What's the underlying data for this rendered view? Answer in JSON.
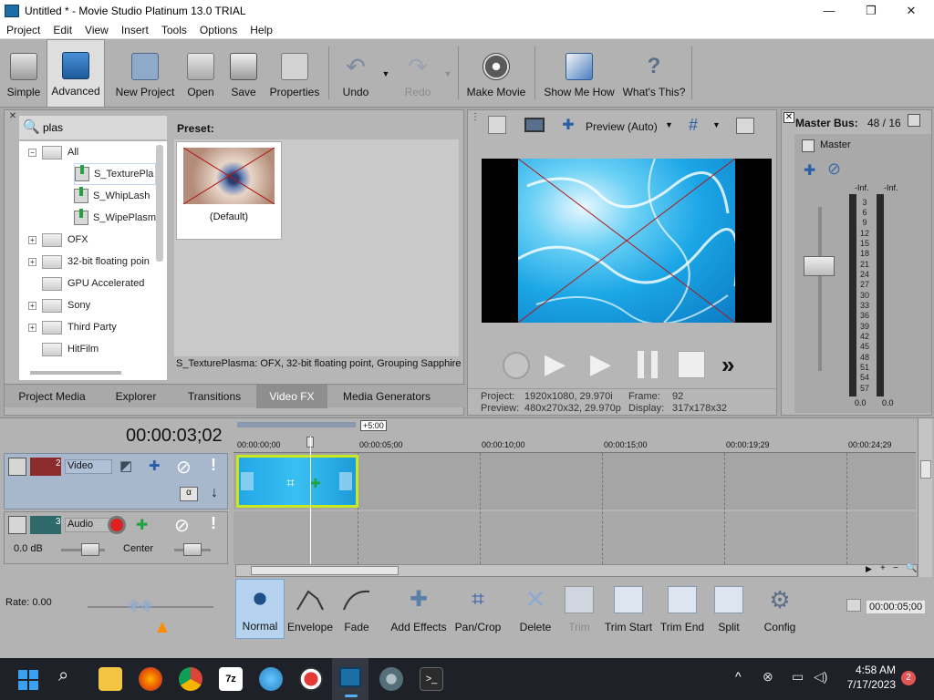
{
  "window": {
    "title": "Untitled * - Movie Studio Platinum 13.0 TRIAL",
    "minimize_icon": "minimize-icon",
    "maximize_icon": "restore-icon",
    "close_icon": "close-icon"
  },
  "menu": [
    "Project",
    "Edit",
    "View",
    "Insert",
    "Tools",
    "Options",
    "Help"
  ],
  "toolbar": {
    "simple": "Simple",
    "advanced": "Advanced",
    "new_project": "New Project",
    "open": "Open",
    "save": "Save",
    "properties": "Properties",
    "undo": "Undo",
    "redo": "Redo",
    "make_movie": "Make Movie",
    "show_me_how": "Show Me How",
    "whats_this": "What's This?"
  },
  "fx_browser": {
    "search_value": "plas",
    "preset_label": "Preset:",
    "preset_thumb_label": "(Default)",
    "status_text": "S_TexturePlasma: OFX, 32-bit floating point, Grouping  Sapphire",
    "tree": [
      {
        "label": "All",
        "expander": "−"
      },
      {
        "label": "S_TexturePla"
      },
      {
        "label": "S_WhipLash"
      },
      {
        "label": "S_WipePlasm"
      },
      {
        "label": "OFX",
        "expander": "+"
      },
      {
        "label": "32-bit floating poin",
        "expander": "+"
      },
      {
        "label": "GPU Accelerated"
      },
      {
        "label": "Sony",
        "expander": "+"
      },
      {
        "label": "Third Party",
        "expander": "+"
      },
      {
        "label": "HitFilm"
      }
    ],
    "tabs": [
      "Project Media",
      "Explorer",
      "Transitions",
      "Video FX",
      "Media Generators"
    ],
    "active_tab": "Video FX"
  },
  "preview": {
    "mode": "Preview (Auto)",
    "project_label": "Project:",
    "project_value": "1920x1080, 29.970i",
    "preview_label": "Preview:",
    "preview_value": "480x270x32, 29.970p",
    "frame_label": "Frame:",
    "frame_value": "92",
    "display_label": "Display:",
    "display_value": "317x178x32"
  },
  "master_bus": {
    "title": "Master Bus:",
    "value": "48 / 16",
    "master_label": "Master",
    "inf_left": "-Inf.",
    "inf_right": "-Inf.",
    "scale": [
      "3",
      "6",
      "9",
      "12",
      "15",
      "18",
      "21",
      "24",
      "27",
      "30",
      "33",
      "36",
      "39",
      "42",
      "45",
      "48",
      "51",
      "54",
      "57"
    ],
    "bottom_left": "0.0",
    "bottom_right": "0.0"
  },
  "timeline": {
    "timecode": "00:00:03;02",
    "loop_length": "+5:00",
    "ruler": [
      "00:00:00;00",
      "00:00:05;00",
      "00:00:10;00",
      "00:00:15;00",
      "00:00:19;29",
      "00:00:24;29"
    ],
    "track_video": {
      "number": "2",
      "name": "Video"
    },
    "track_audio": {
      "number": "3",
      "name": "Audio",
      "volume": "0.0 dB",
      "pan": "Center"
    },
    "rate_label": "Rate: 0.00",
    "end_time": "00:00:05;00"
  },
  "edit_tools": {
    "normal": "Normal",
    "envelope": "Envelope",
    "fade": "Fade",
    "add_effects": "Add Effects",
    "pan_crop": "Pan/Crop",
    "delete": "Delete",
    "trim": "Trim",
    "trim_start": "Trim Start",
    "trim_end": "Trim End",
    "split": "Split",
    "config": "Config"
  },
  "taskbar": {
    "time": "4:58 AM",
    "date": "7/17/2023",
    "notification_count": "2"
  },
  "colors": {
    "accent": "#1a8fd6",
    "clip_border": "#c8e820",
    "toolbar_bg": "#b2b2b2",
    "panel_bg": "#b6b6b6"
  }
}
